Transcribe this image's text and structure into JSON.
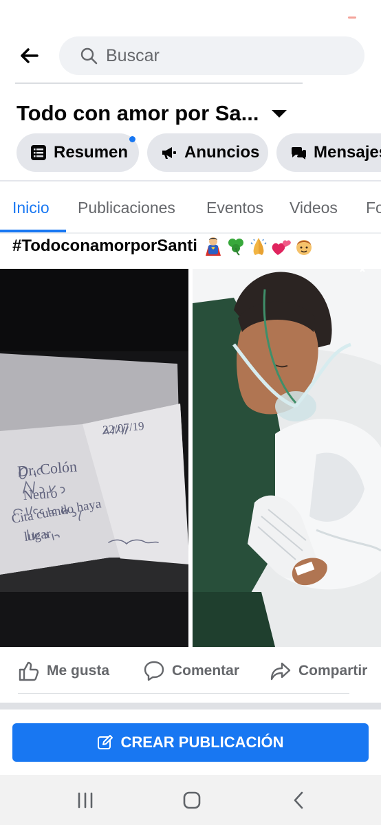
{
  "status_bar": {
    "indicator_color": "#f4a39a"
  },
  "search": {
    "back_icon": "back-arrow-icon",
    "icon": "search-icon",
    "placeholder": "Buscar"
  },
  "page": {
    "title": "Todo con amor por Sa...",
    "title_caret_icon": "caret-down-icon"
  },
  "chips": [
    {
      "label": "Resumen",
      "icon": "list-icon",
      "has_notification_dot": true
    },
    {
      "label": "Anuncios",
      "icon": "megaphone-icon"
    },
    {
      "label": "Mensajes",
      "icon": "chat-icon"
    }
  ],
  "tabs": [
    {
      "label": "Inicio",
      "active": true
    },
    {
      "label": "Publicaciones"
    },
    {
      "label": "Eventos"
    },
    {
      "label": "Videos"
    },
    {
      "label": "Fo"
    }
  ],
  "post": {
    "text": "#TodoconamorporSanti",
    "emoji_icons": [
      "superhero-icon",
      "shamrock-icon",
      "praying-hands-icon",
      "two-hearts-icon",
      "child-face-icon"
    ],
    "photos": [
      {
        "description_icon": "handwritten-note-photo",
        "note_lines": [
          "22/07/19",
          "Dr. Colón",
          "Neuro",
          "Cita cuando haya",
          "lugar"
        ]
      },
      {
        "description_icon": "child-hospital-bed-photo"
      }
    ],
    "actions": [
      {
        "label": "Me gusta",
        "icon": "thumbs-up-icon"
      },
      {
        "label": "Comentar",
        "icon": "comment-icon"
      },
      {
        "label": "Compartir",
        "icon": "share-icon"
      }
    ]
  },
  "create_post": {
    "label": "CREAR PUBLICACIÓN",
    "icon": "edit-icon"
  },
  "colors": {
    "brand_blue": "#1877f2",
    "chip_bg": "#e4e6eb",
    "muted_text": "#65676b"
  },
  "system_nav": {
    "icons": [
      "recent-apps-icon",
      "home-icon",
      "back-icon"
    ]
  }
}
